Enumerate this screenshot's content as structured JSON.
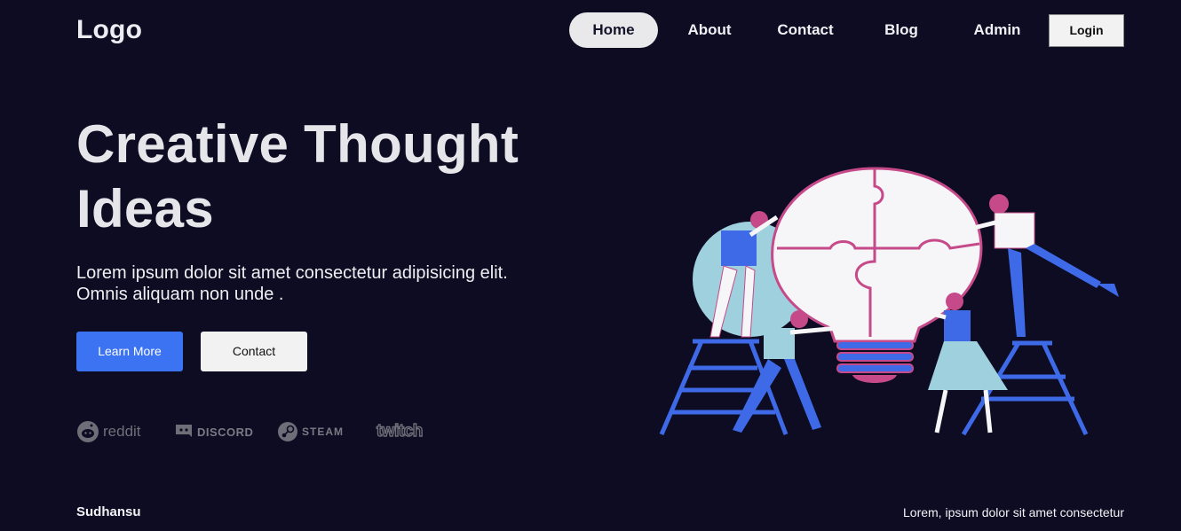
{
  "header": {
    "logo": "Logo",
    "nav": [
      {
        "label": "Home",
        "active": true
      },
      {
        "label": "About",
        "active": false
      },
      {
        "label": "Contact",
        "active": false
      },
      {
        "label": "Blog",
        "active": false
      },
      {
        "label": "Admin",
        "active": false
      }
    ],
    "login_label": "Login"
  },
  "hero": {
    "title_line1": "Creative Thought",
    "title_line2": "Ideas",
    "subtitle_line1": "Lorem ipsum dolor sit amet consectetur adipisicing elit.",
    "subtitle_line2": "Omnis aliquam non unde .",
    "primary_button": "Learn More",
    "secondary_button": "Contact"
  },
  "brands": [
    {
      "name": "reddit",
      "icon": "reddit-icon"
    },
    {
      "name": "DISCORD",
      "icon": "discord-icon"
    },
    {
      "name": "STEAM",
      "icon": "steam-icon"
    },
    {
      "name": "twitch",
      "icon": "twitch-icon"
    }
  ],
  "footer": {
    "left": "Sudhansu",
    "right": "Lorem, ipsum dolor sit amet consectetur"
  },
  "colors": {
    "background": "#0d0c22",
    "primary": "#3c73f2",
    "illustration_blue": "#3e6ae8",
    "illustration_pink": "#c64a8a",
    "illustration_light": "#9fd0dd"
  }
}
